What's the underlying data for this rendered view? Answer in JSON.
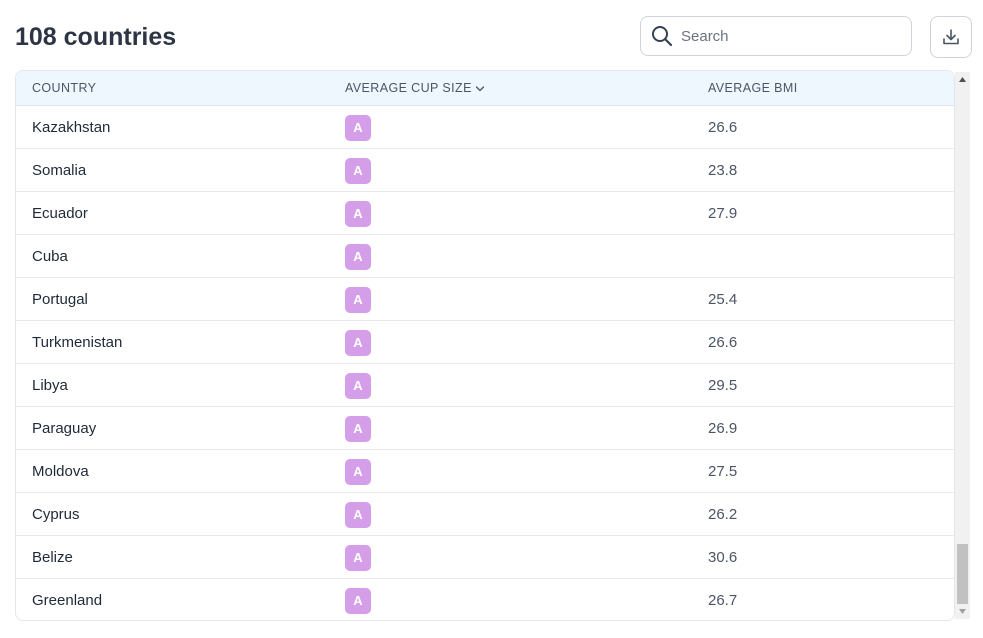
{
  "header": {
    "title": "108 countries",
    "search_placeholder": "Search",
    "search_value": ""
  },
  "icons": {
    "search": "search-icon",
    "download": "download-icon",
    "sort": "chevron-down-icon"
  },
  "colors": {
    "cup_badge": "#d59ee8",
    "header_bg": "#eff7fe"
  },
  "table": {
    "columns": [
      "COUNTRY",
      "AVERAGE CUP SIZE",
      "AVERAGE BMI"
    ],
    "rows": [
      {
        "country": "Kazakhstan",
        "cup": "A",
        "bmi": "26.6"
      },
      {
        "country": "Somalia",
        "cup": "A",
        "bmi": "23.8"
      },
      {
        "country": "Ecuador",
        "cup": "A",
        "bmi": "27.9"
      },
      {
        "country": "Cuba",
        "cup": "A",
        "bmi": ""
      },
      {
        "country": "Portugal",
        "cup": "A",
        "bmi": "25.4"
      },
      {
        "country": "Turkmenistan",
        "cup": "A",
        "bmi": "26.6"
      },
      {
        "country": "Libya",
        "cup": "A",
        "bmi": "29.5"
      },
      {
        "country": "Paraguay",
        "cup": "A",
        "bmi": "26.9"
      },
      {
        "country": "Moldova",
        "cup": "A",
        "bmi": "27.5"
      },
      {
        "country": "Cyprus",
        "cup": "A",
        "bmi": "26.2"
      },
      {
        "country": "Belize",
        "cup": "A",
        "bmi": "30.6"
      },
      {
        "country": "Greenland",
        "cup": "A",
        "bmi": "26.7"
      }
    ]
  }
}
